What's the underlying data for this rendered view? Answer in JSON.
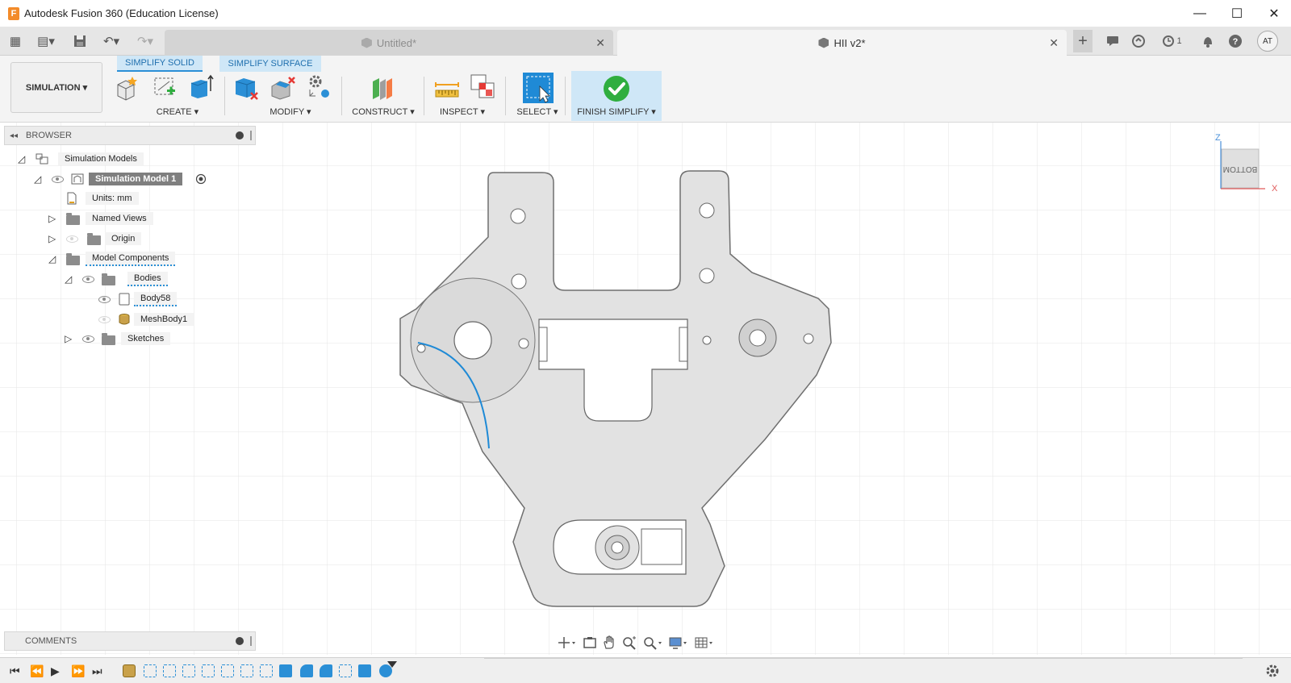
{
  "window": {
    "title": "Autodesk Fusion 360 (Education License)",
    "app_icon_letter": "F",
    "controls": {
      "minimize": "—",
      "maximize": "☐",
      "close": "✕"
    }
  },
  "quick_access": {
    "grid": "▦",
    "file": "▤▾",
    "save": "💾",
    "undo": "↶▾",
    "redo": "↷▾"
  },
  "tabs": [
    {
      "label": "Untitled*",
      "active": false,
      "close": "✕"
    },
    {
      "label": "HII v2*",
      "active": true,
      "close": "✕"
    }
  ],
  "right_icons": {
    "new_tab": "+",
    "job_status_count": "1",
    "user_initials": "AT"
  },
  "toolbar": {
    "workspace": "SIMULATION ▾",
    "context_tabs": [
      "SIMPLIFY SOLID",
      "SIMPLIFY SURFACE"
    ],
    "groups": {
      "create": "CREATE ▾",
      "modify": "MODIFY ▾",
      "construct": "CONSTRUCT ▾",
      "inspect": "INSPECT ▾",
      "select": "SELECT ▾",
      "finish": "FINISH SIMPLIFY ▾"
    }
  },
  "browser": {
    "title": "BROWSER",
    "items": [
      {
        "label": "Simulation Models"
      },
      {
        "label": "Simulation Model 1"
      },
      {
        "label": "Units: mm"
      },
      {
        "label": "Named Views"
      },
      {
        "label": "Origin"
      },
      {
        "label": "Model Components"
      },
      {
        "label": "Bodies"
      },
      {
        "label": "Body58"
      },
      {
        "label": "MeshBody1"
      },
      {
        "label": "Sketches"
      }
    ]
  },
  "comments": {
    "title": "COMMENTS"
  },
  "viewcube": {
    "face": "BOTTOM",
    "axis_z": "Z",
    "axis_x": "X"
  },
  "colors": {
    "accent": "#2b8fd6",
    "selection_blue": "#1f8ad6",
    "finish_green": "#2fae3f",
    "context_tab_bg": "#cfe7f7",
    "part_fill": "#e2e2e2"
  }
}
